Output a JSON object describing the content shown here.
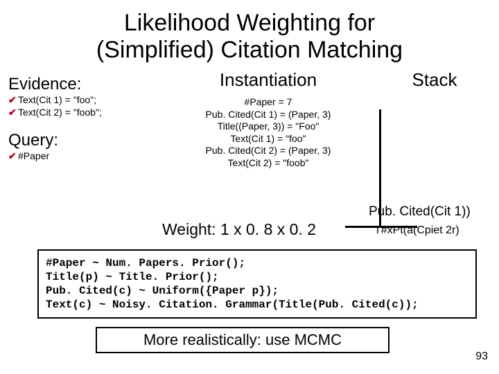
{
  "title_line1": "Likelihood Weighting for",
  "title_line2": "(Simplified) Citation Matching",
  "columns": {
    "instantiation_header": "Instantiation",
    "stack_header": "Stack"
  },
  "left": {
    "evidence_header": "Evidence:",
    "evidence_items": {
      "e1": "Text(Cit 1) = \"foo\";",
      "e2": "Text(Cit 2) = \"foob\";"
    },
    "query_header": "Query:",
    "query_item": "#Paper"
  },
  "instantiation_lines": {
    "l1": "#Paper = 7",
    "l2": "Pub. Cited(Cit 1) = (Paper, 3)",
    "l3": "Title((Paper, 3)) = \"Foo\"",
    "l4": "Text(Cit 1) = \"foo\"",
    "l5": "Pub. Cited(Cit 2) = (Paper, 3)",
    "l6": "Text(Cit 2) = \"foob\""
  },
  "stack_overlay": "Pub. Cited(Cit 1))",
  "weight": "Weight: 1 x 0. 8 x 0. 2",
  "weight_note": "T#xPt(a(Cpiet 2r)",
  "code": {
    "c1": "#Paper ~ Num. Papers. Prior();",
    "c2": "Title(p) ~ Title. Prior();",
    "c3": "Pub. Cited(c) ~ Uniform({Paper p});",
    "c4": "Text(c) ~ Noisy. Citation. Grammar(Title(Pub. Cited(c));"
  },
  "mcmc": "More realistically: use MCMC",
  "page_number": "93"
}
